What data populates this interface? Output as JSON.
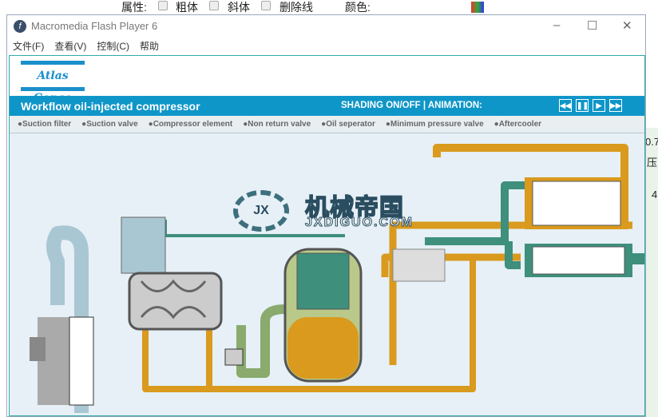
{
  "background": {
    "props_label": "属性:",
    "bold": "粗体",
    "italic": "斜体",
    "strike": "删除线",
    "color_label": "颜色:",
    "right_values": [
      "0.7",
      "压",
      "4"
    ]
  },
  "window": {
    "title": "Macromedia Flash Player 6",
    "min": "–",
    "max": "☐",
    "close": "✕"
  },
  "menu": [
    "文件(F)",
    "查看(V)",
    "控制(C)",
    "帮助"
  ],
  "app": {
    "logo": "Atlas Copco",
    "title": "Workflow oil-injected compressor",
    "shading": "SHADING ON/OFF | ANIMATION:",
    "controls": [
      {
        "name": "rewind",
        "glyph": "◀◀"
      },
      {
        "name": "pause",
        "glyph": "❚❚"
      },
      {
        "name": "play",
        "glyph": "▶"
      },
      {
        "name": "fast-forward",
        "glyph": "▶▶"
      }
    ],
    "parts": [
      "●Suction filter",
      "●Suction valve",
      "●Compressor element",
      "●Non return valve",
      "●Oil seperator",
      "●Minimum pressure valve",
      "●Aftercooler"
    ]
  },
  "watermark": {
    "cn": "机械帝国",
    "url": "JXDIGUO.COM"
  },
  "colors": {
    "blue": "#0f96c8",
    "oil": "#d99a1e",
    "air": "#a9c7d3",
    "green": "#3e8f7c"
  }
}
